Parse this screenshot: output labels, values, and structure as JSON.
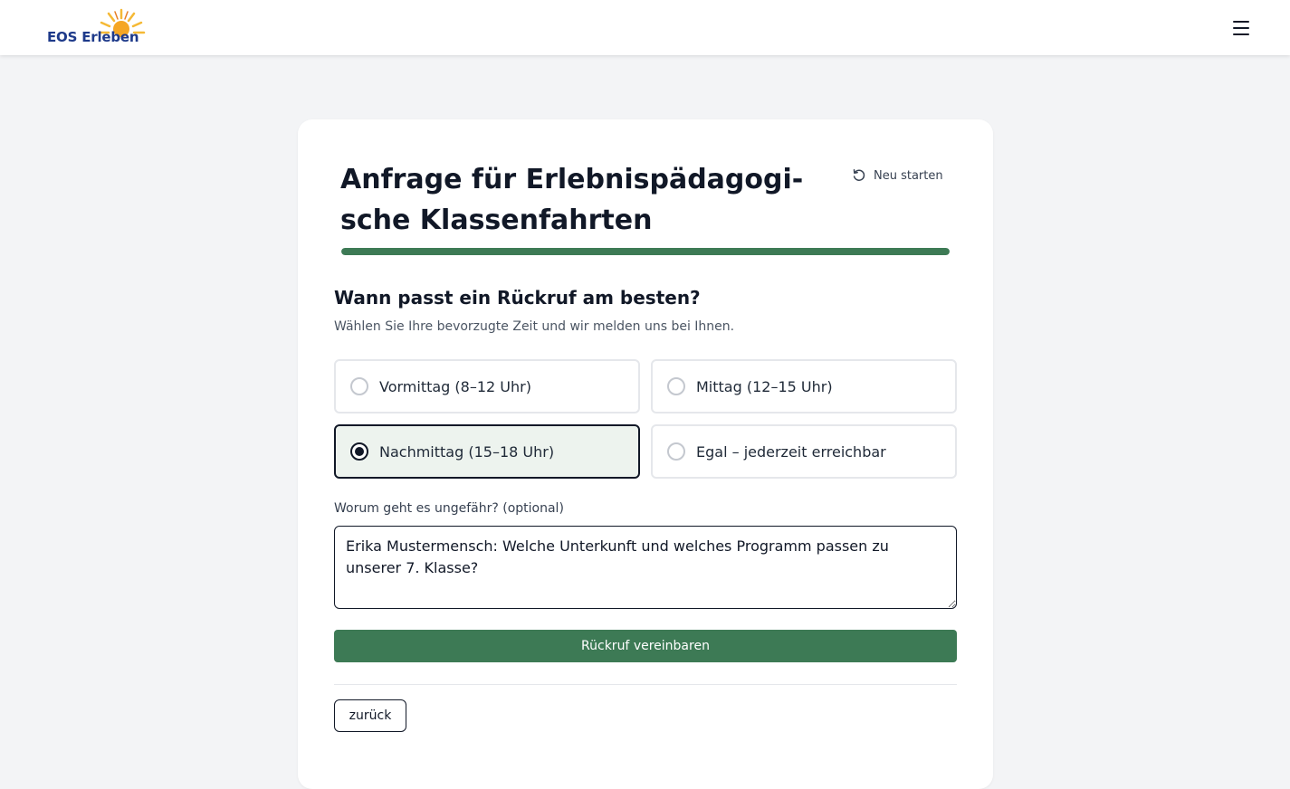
{
  "header": {
    "logo_text": "EOS Erleben",
    "menu_icon": "hamburger-menu-icon"
  },
  "form": {
    "title": "Anfrage für Erlebnispädagogi-sche Klassenfahrten",
    "restart_label": "Neu starten",
    "progress_percent": 100,
    "question": "Wann passt ein Rückruf am besten?",
    "subtitle": "Wählen Sie Ihre bevorzugte Zeit und wir melden uns bei Ihnen.",
    "options": [
      {
        "label": "Vormittag (8–12 Uhr)",
        "selected": false
      },
      {
        "label": "Mittag (12–15 Uhr)",
        "selected": false
      },
      {
        "label": "Nachmittag (15–18 Uhr)",
        "selected": true
      },
      {
        "label": "Egal – jederzeit erreichbar",
        "selected": false
      }
    ],
    "textarea_label": "Worum geht es ungefähr? (optional)",
    "textarea_value": "Erika Mustermensch: Welche Unterkunft und welches Programm passen zu unserer 7. Klasse?",
    "submit_label": "Rückruf vereinbaren",
    "back_label": "zurück"
  },
  "colors": {
    "accent": "#3d7a55",
    "selected_bg": "#edf3ee",
    "logo_blue": "#1e3a8a",
    "logo_sun": "#f5a623"
  }
}
